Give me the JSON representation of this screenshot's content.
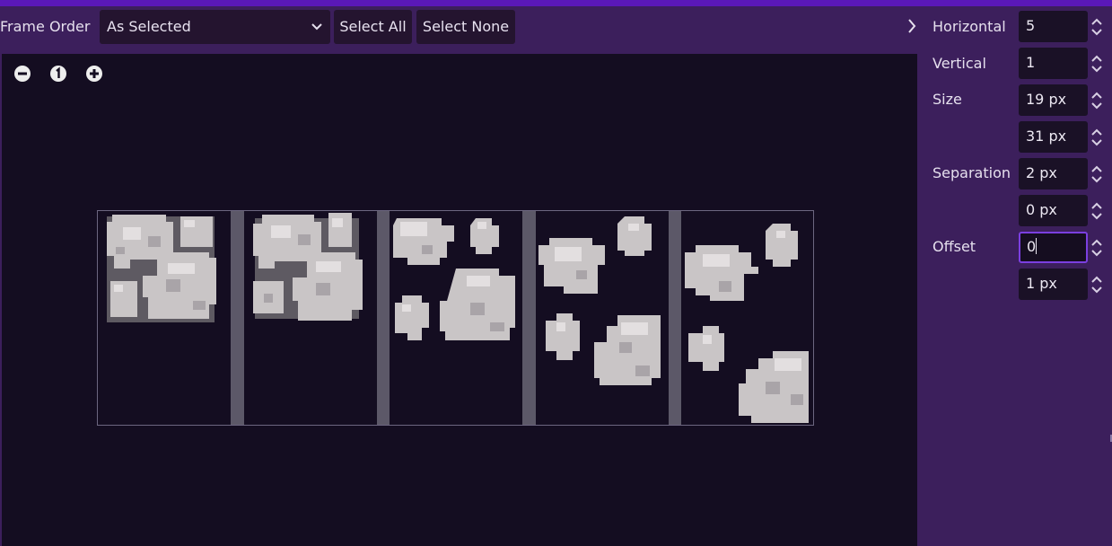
{
  "toolbar": {
    "frame_order_label": "Frame Order",
    "frame_order_value": "As Selected",
    "select_all_label": "Select All",
    "select_none_label": "Select None"
  },
  "colors": {
    "accent": "#7b3fe0",
    "panel_bg": "#3c1f5c",
    "preview_bg": "#140d21",
    "top_strip": "#5a18b8"
  },
  "preview": {
    "zoom_out_icon": "zoom-out-icon",
    "zoom_reset_icon": "zoom-reset-icon",
    "zoom_in_icon": "zoom-in-icon"
  },
  "inspector": {
    "horizontal_label": "Horizontal",
    "horizontal_value": "5",
    "vertical_label": "Vertical",
    "vertical_value": "1",
    "size_label": "Size",
    "size_x": "19 px",
    "size_y": "31 px",
    "separation_label": "Separation",
    "separation_x": "2 px",
    "separation_y": "0 px",
    "offset_label": "Offset",
    "offset_x": "0",
    "offset_y": "1 px"
  }
}
